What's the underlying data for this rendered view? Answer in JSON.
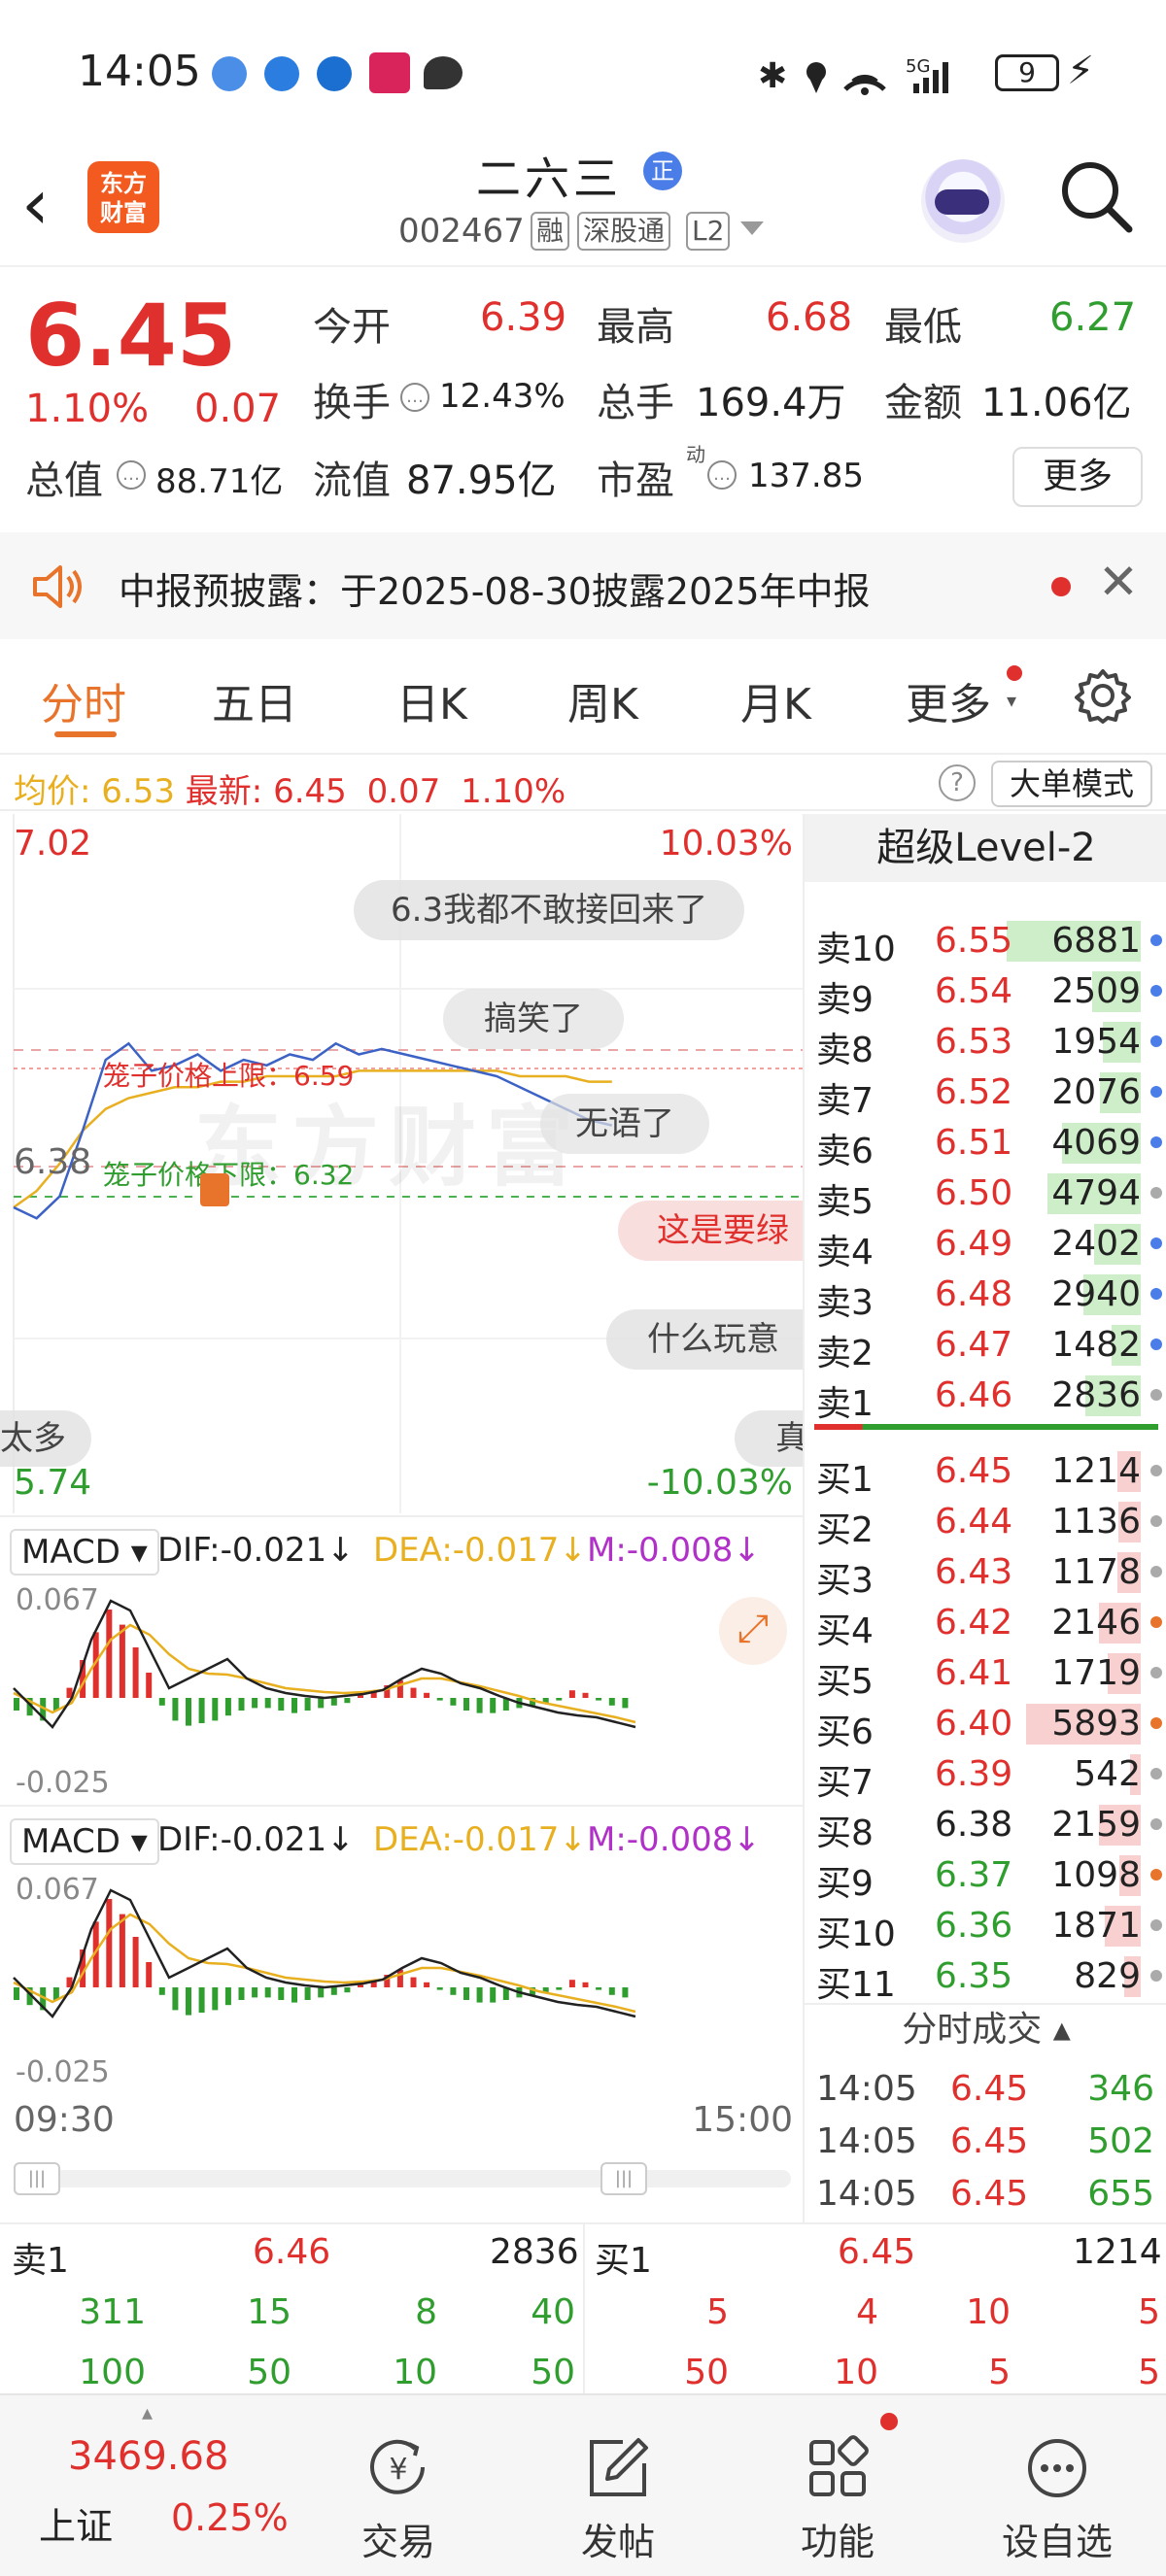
{
  "status_bar": {
    "time": "14:05",
    "network": "5G",
    "battery": "9"
  },
  "header": {
    "back_icon": "back-chevron-icon",
    "logo_line1": "东方",
    "logo_line2": "财富",
    "stock_name": "二六三",
    "badge": "正",
    "stock_code": "002467",
    "tags": [
      "融",
      "深股通",
      "L2"
    ]
  },
  "quote": {
    "price": "6.45",
    "change_pct": "1.10%",
    "change": "0.07",
    "open_label": "今开",
    "open": "6.39",
    "high_label": "最高",
    "high": "6.68",
    "low_label": "最低",
    "low": "6.27",
    "turnover_label": "换手",
    "turnover": "12.43%",
    "volume_label": "总手",
    "volume": "169.4万",
    "amount_label": "金额",
    "amount": "11.06亿",
    "mktcap_label": "总值",
    "mktcap": "88.71亿",
    "float_label": "流值",
    "float": "87.95亿",
    "pe_label": "市盈",
    "pe_sup": "动",
    "pe": "137.85",
    "more": "更多"
  },
  "notice": {
    "text": "中报预披露：于2025-08-30披露2025年中报"
  },
  "tabs": [
    "分时",
    "五日",
    "日K",
    "周K",
    "月K",
    "更多"
  ],
  "chart": {
    "avg_label": "均价:",
    "avg": "6.53",
    "latest_label": "最新:",
    "latest": "6.45",
    "latest_change": "0.07",
    "latest_pct": "1.10%",
    "big_order_btn": "大单模式",
    "y_max": "7.02",
    "y_max_pct": "10.03%",
    "y_min": "5.74",
    "y_min_pct": "-10.03%",
    "y_mid": "6.38",
    "cage_upper": "笼子价格上限：6.59",
    "cage_lower": "笼子价格下限：6.32",
    "watermark": "东方财富",
    "comments": [
      "6.3我都不敢接回来了",
      "搞笑了",
      "无语了",
      "这是要绿",
      "什么玩意",
      "太多",
      "真"
    ],
    "time_start": "09:30",
    "time_end": "15:00",
    "price_series": [
      6.3,
      6.28,
      6.32,
      6.44,
      6.57,
      6.6,
      6.55,
      6.56,
      6.58,
      6.55,
      6.57,
      6.56,
      6.58,
      6.57,
      6.6,
      6.58,
      6.59,
      6.58,
      6.57,
      6.56,
      6.55,
      6.54,
      6.52,
      6.5,
      6.48,
      6.46,
      6.45
    ],
    "avg_series": [
      6.3,
      6.33,
      6.38,
      6.44,
      6.48,
      6.5,
      6.51,
      6.52,
      6.52,
      6.53,
      6.53,
      6.54,
      6.54,
      6.54,
      6.54,
      6.55,
      6.55,
      6.55,
      6.55,
      6.55,
      6.55,
      6.55,
      6.54,
      6.54,
      6.54,
      6.53,
      6.53
    ]
  },
  "macd": [
    {
      "label": "MACD",
      "dif": "DIF:-0.021",
      "dea": "DEA:-0.017",
      "m": "M:-0.008",
      "top": "0.067",
      "bottom": "-0.025"
    },
    {
      "label": "MACD",
      "dif": "DIF:-0.021",
      "dea": "DEA:-0.017",
      "m": "M:-0.008",
      "top": "0.067",
      "bottom": "-0.025"
    }
  ],
  "level2": {
    "title": "超级Level-2",
    "asks": [
      {
        "label": "卖10",
        "price": "6.55",
        "vol": "6881"
      },
      {
        "label": "卖9",
        "price": "6.54",
        "vol": "2509"
      },
      {
        "label": "卖8",
        "price": "6.53",
        "vol": "1954"
      },
      {
        "label": "卖7",
        "price": "6.52",
        "vol": "2076"
      },
      {
        "label": "卖6",
        "price": "6.51",
        "vol": "4069"
      },
      {
        "label": "卖5",
        "price": "6.50",
        "vol": "4794"
      },
      {
        "label": "卖4",
        "price": "6.49",
        "vol": "2402"
      },
      {
        "label": "卖3",
        "price": "6.48",
        "vol": "2940"
      },
      {
        "label": "卖2",
        "price": "6.47",
        "vol": "1482"
      },
      {
        "label": "卖1",
        "price": "6.46",
        "vol": "2836"
      }
    ],
    "bids": [
      {
        "label": "买1",
        "price": "6.45",
        "vol": "1214"
      },
      {
        "label": "买2",
        "price": "6.44",
        "vol": "1136"
      },
      {
        "label": "买3",
        "price": "6.43",
        "vol": "1178"
      },
      {
        "label": "买4",
        "price": "6.42",
        "vol": "2146"
      },
      {
        "label": "买5",
        "price": "6.41",
        "vol": "1719"
      },
      {
        "label": "买6",
        "price": "6.40",
        "vol": "5893"
      },
      {
        "label": "买7",
        "price": "6.39",
        "vol": "542"
      },
      {
        "label": "买8",
        "price": "6.38",
        "vol": "2159"
      },
      {
        "label": "买9",
        "price": "6.37",
        "vol": "1098"
      },
      {
        "label": "买10",
        "price": "6.36",
        "vol": "1871"
      },
      {
        "label": "买11",
        "price": "6.35",
        "vol": "829"
      }
    ],
    "ticks_title": "分时成交",
    "ticks": [
      {
        "time": "14:05",
        "price": "6.45",
        "vol": "346"
      },
      {
        "time": "14:05",
        "price": "6.45",
        "vol": "502"
      },
      {
        "time": "14:05",
        "price": "6.45",
        "vol": "655"
      }
    ]
  },
  "queue": {
    "sell_label": "卖1",
    "sell_price": "6.46",
    "sell_vol": "2836",
    "buy_label": "买1",
    "buy_price": "6.45",
    "buy_vol": "1214",
    "sell_row1": [
      "311",
      "15",
      "8",
      "40"
    ],
    "sell_row2": [
      "100",
      "50",
      "10",
      "50"
    ],
    "buy_row1": [
      "5",
      "4",
      "10",
      "5"
    ],
    "buy_row2": [
      "50",
      "10",
      "5",
      "5"
    ]
  },
  "bottom_nav": {
    "index_value": "3469.68",
    "index_name": "上证",
    "index_pct": "0.25%",
    "items": [
      "交易",
      "发帖",
      "功能",
      "设自选"
    ]
  },
  "colors": {
    "up": "#e0302d",
    "down": "#2f9e2f",
    "accent": "#e8742c",
    "avg_line": "#e8b020"
  }
}
